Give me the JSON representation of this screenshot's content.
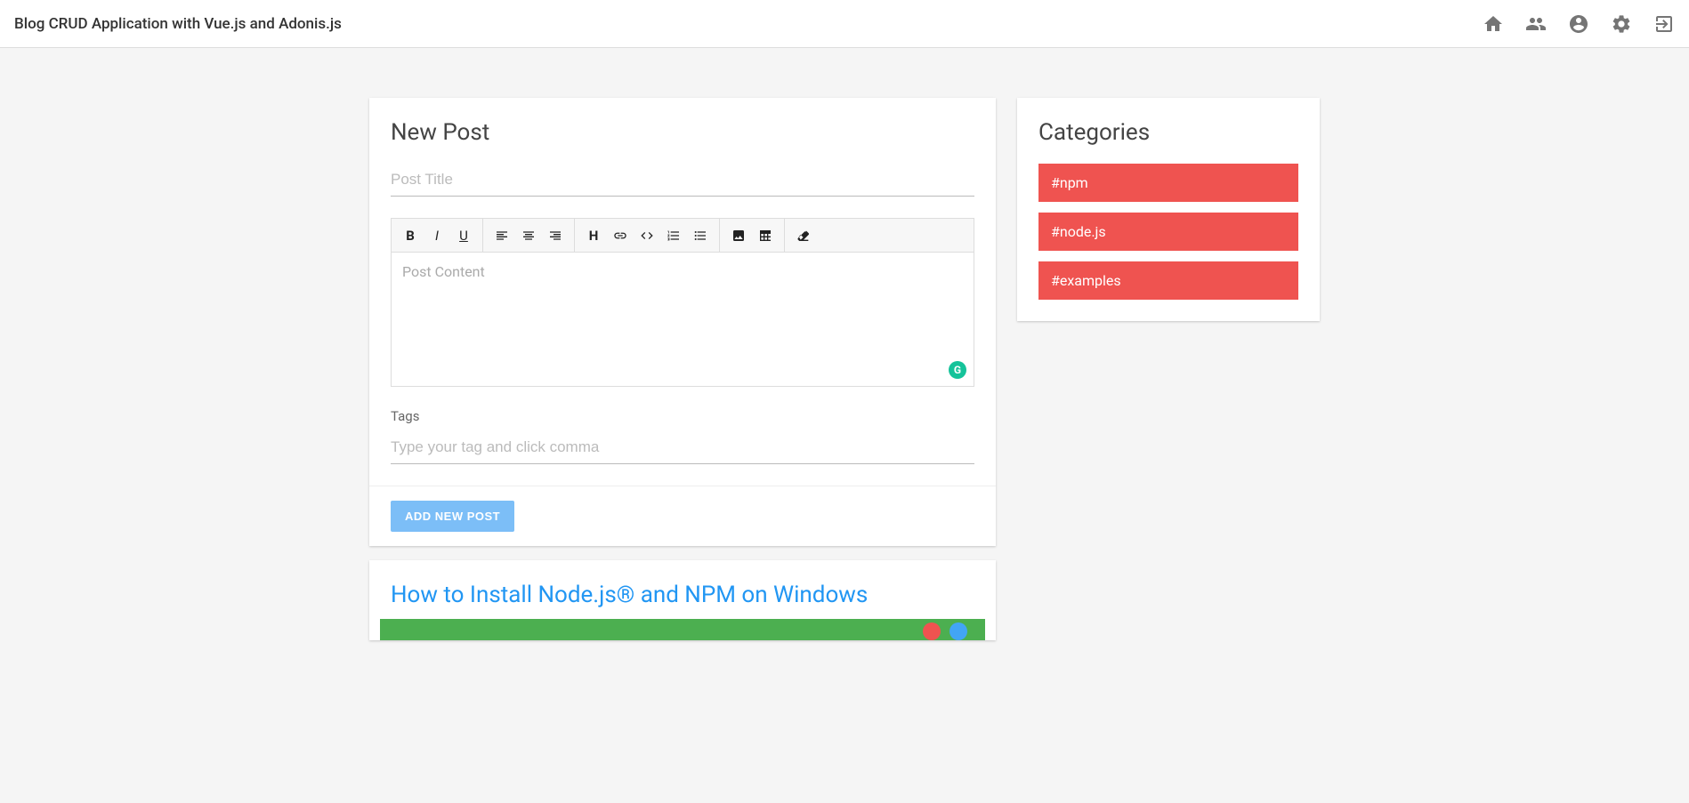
{
  "header": {
    "title": "Blog CRUD Application with Vue.js and Adonis.js"
  },
  "newPost": {
    "title": "New Post",
    "titlePlaceholder": "Post Title",
    "contentPlaceholder": "Post Content",
    "tagsLabel": "Tags",
    "tagsPlaceholder": "Type your tag and click comma",
    "submitLabel": "ADD NEW POST"
  },
  "categories": {
    "title": "Categories",
    "items": [
      {
        "label": "#npm"
      },
      {
        "label": "#node.js"
      },
      {
        "label": "#examples"
      }
    ]
  },
  "post": {
    "title": "How to Install Node.js® and NPM on Windows"
  },
  "grammarly": "G"
}
